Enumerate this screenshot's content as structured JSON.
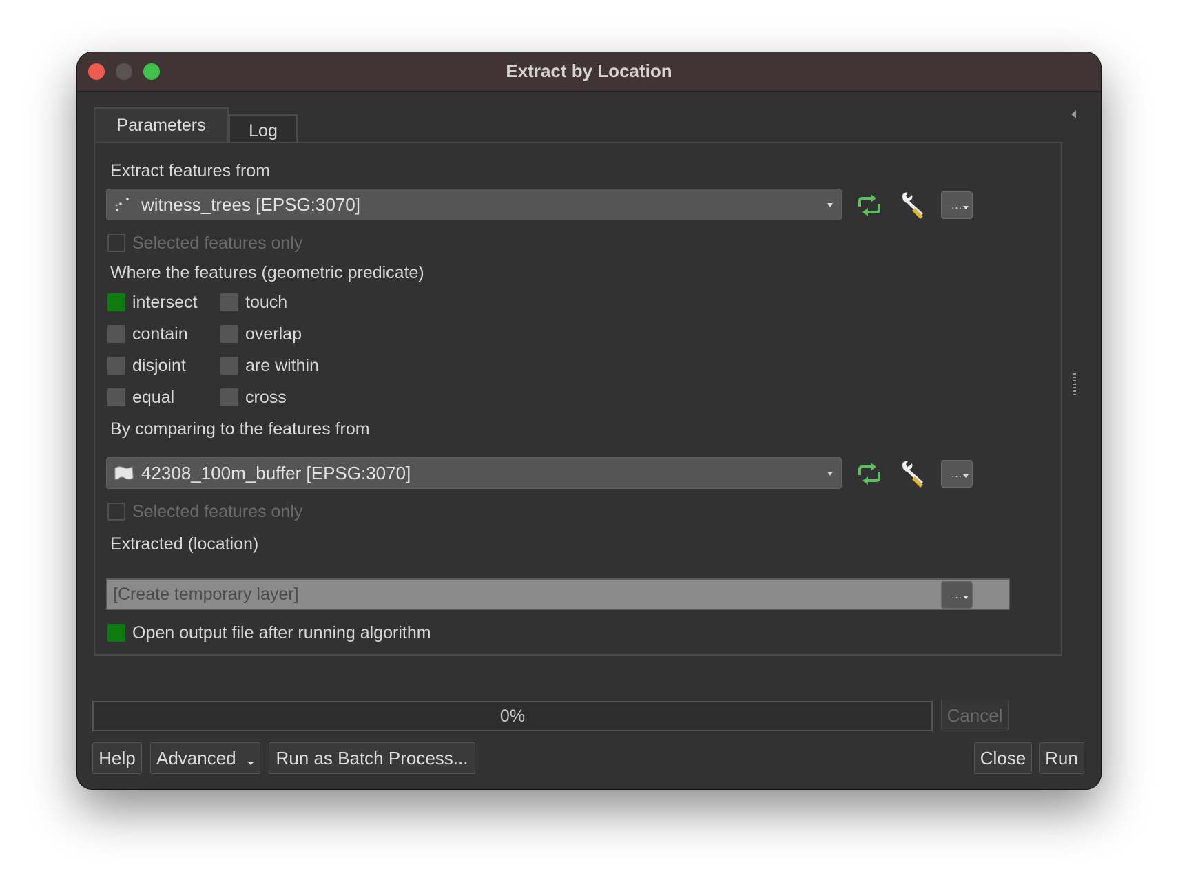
{
  "window": {
    "title": "Extract by Location"
  },
  "tabs": [
    {
      "label": "Parameters",
      "active": true
    },
    {
      "label": "Log",
      "active": false
    }
  ],
  "input_layer": {
    "label": "Extract features from",
    "value": "witness_trees [EPSG:3070]",
    "layer_icon": "point-layer-icon",
    "selected_only_label": "Selected features only",
    "selected_only_checked": false
  },
  "predicate": {
    "label": "Where the features (geometric predicate)",
    "options": [
      {
        "label": "intersect",
        "checked": true
      },
      {
        "label": "touch",
        "checked": false
      },
      {
        "label": "contain",
        "checked": false
      },
      {
        "label": "overlap",
        "checked": false
      },
      {
        "label": "disjoint",
        "checked": false
      },
      {
        "label": "are within",
        "checked": false
      },
      {
        "label": "equal",
        "checked": false
      },
      {
        "label": "cross",
        "checked": false
      }
    ]
  },
  "compare_layer": {
    "label": "By comparing to the features from",
    "value": "42308_100m_buffer [EPSG:3070]",
    "layer_icon": "polygon-layer-icon",
    "selected_only_label": "Selected features only",
    "selected_only_checked": false
  },
  "output": {
    "label": "Extracted (location)",
    "placeholder": "[Create temporary layer]",
    "value": "",
    "open_after_label": "Open output file after running algorithm",
    "open_after_checked": true
  },
  "dots_label": "...",
  "progress": {
    "percent": 0,
    "text": "0%"
  },
  "buttons": {
    "cancel": "Cancel",
    "help": "Help",
    "advanced": "Advanced",
    "batch": "Run as Batch Process...",
    "close": "Close",
    "run": "Run"
  },
  "colors": {
    "checked": "#0f7a10",
    "iterate_icon": "#5fbf5f",
    "titlebar": "#403534"
  }
}
